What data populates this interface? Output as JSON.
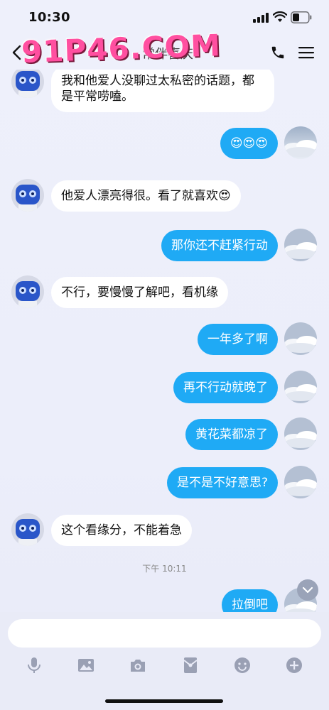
{
  "status_bar": {
    "time": "10:30"
  },
  "header": {
    "title": "常伴喜庆",
    "watermark": "91P46.COM"
  },
  "messages": [
    {
      "side": "in",
      "text": "我和他爱人没聊过太私密的话题，都是平常唠嗑。"
    },
    {
      "side": "out",
      "text": "😍😍😍"
    },
    {
      "side": "in",
      "text": "他爱人漂亮得很。看了就喜欢😍"
    },
    {
      "side": "out",
      "text": "那你还不赶紧行动"
    },
    {
      "side": "in",
      "text": "不行，要慢慢了解吧，看机缘"
    },
    {
      "side": "out",
      "text": "一年多了啊"
    },
    {
      "side": "out",
      "text": "再不行动就晚了"
    },
    {
      "side": "out",
      "text": "黄花菜都凉了"
    },
    {
      "side": "out",
      "text": "是不是不好意思?"
    },
    {
      "side": "in",
      "text": "这个看缘分，不能着急"
    },
    {
      "side": "out",
      "text": "拉倒吧"
    }
  ],
  "time_divider": "下午 10:11",
  "input": {
    "placeholder": ""
  },
  "toolbar": {
    "icons": [
      "microphone-icon",
      "image-icon",
      "camera-icon",
      "red-packet-icon",
      "emoji-icon",
      "plus-icon"
    ]
  },
  "colors": {
    "outgoing_bubble": "#1faaf5",
    "incoming_bubble": "#ffffff",
    "background": "#eceefa"
  }
}
